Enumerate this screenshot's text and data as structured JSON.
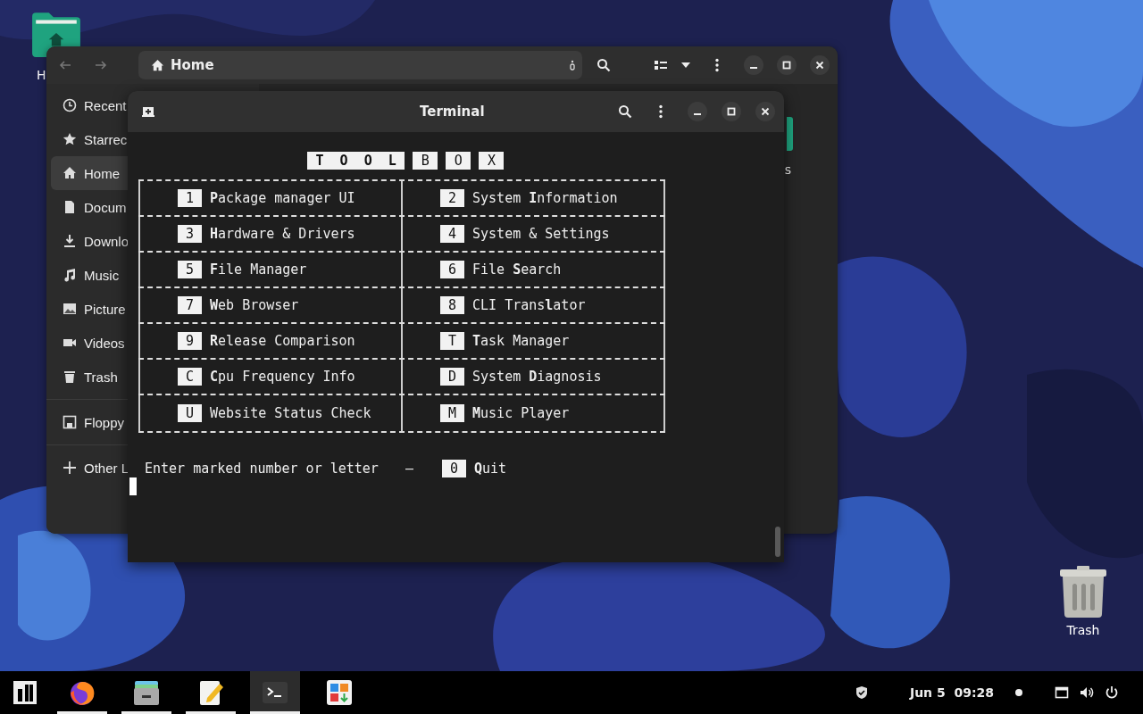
{
  "desktop": {
    "icons": [
      {
        "label": "H"
      },
      {
        "label": "Trash"
      }
    ]
  },
  "file_manager": {
    "path": "Home",
    "sidebar": {
      "sections": [
        {
          "items": [
            {
              "label": "Recent",
              "selected": false
            },
            {
              "label": "Starrec",
              "selected": false
            },
            {
              "label": "Home",
              "selected": true
            },
            {
              "label": "Docum",
              "selected": false
            },
            {
              "label": "Downlo",
              "selected": false
            },
            {
              "label": "Music",
              "selected": false
            },
            {
              "label": "Picture",
              "selected": false
            },
            {
              "label": "Videos",
              "selected": false
            },
            {
              "label": "Trash",
              "selected": false
            }
          ]
        },
        {
          "items": [
            {
              "label": "Floppy",
              "selected": false
            }
          ]
        },
        {
          "items": [
            {
              "label": "Other L",
              "selected": false
            }
          ]
        }
      ]
    },
    "content_items": [
      {
        "label": "s"
      }
    ]
  },
  "terminal": {
    "title": "Terminal",
    "banner": [
      "**T  O  O  L**",
      "B",
      "O",
      "X"
    ],
    "rows": [
      [
        {
          "key": "1",
          "label": "**P**ackage manager UI"
        },
        {
          "key": "2",
          "label": "System **I**nformation"
        }
      ],
      [
        {
          "key": "3",
          "label": "**H**ardware & Drivers"
        },
        {
          "key": "4",
          "label": "System & Settings"
        }
      ],
      [
        {
          "key": "5",
          "label": "**F**ile Manager"
        },
        {
          "key": "6",
          "label": "File **S**earch"
        }
      ],
      [
        {
          "key": "7",
          "label": "**W**eb Browser"
        },
        {
          "key": "8",
          "label": "CLI Trans**l**ator"
        }
      ],
      [
        {
          "key": "9",
          "label": "**R**elease Comparison"
        },
        {
          "key": "T",
          "label": "**T**ask Manager"
        }
      ],
      [
        {
          "key": "C",
          "label": "**C**pu Frequency Info"
        },
        {
          "key": "D",
          "label": "System **D**iagnosis"
        }
      ],
      [
        {
          "key": "U",
          "label": "Website Status Check"
        },
        {
          "key": "M",
          "label": "**M**usic Player"
        }
      ]
    ],
    "prompt": "Enter marked number or letter",
    "separator": "–",
    "quit": {
      "key": "0",
      "label": "**Q**uit"
    }
  },
  "taskbar": {
    "apps": [
      {
        "running": true,
        "selected": false
      },
      {
        "running": true,
        "selected": false
      },
      {
        "running": true,
        "selected": false
      },
      {
        "running": true,
        "selected": true
      },
      {
        "running": false,
        "selected": false
      }
    ],
    "clock": "Jun 5  09:28"
  }
}
